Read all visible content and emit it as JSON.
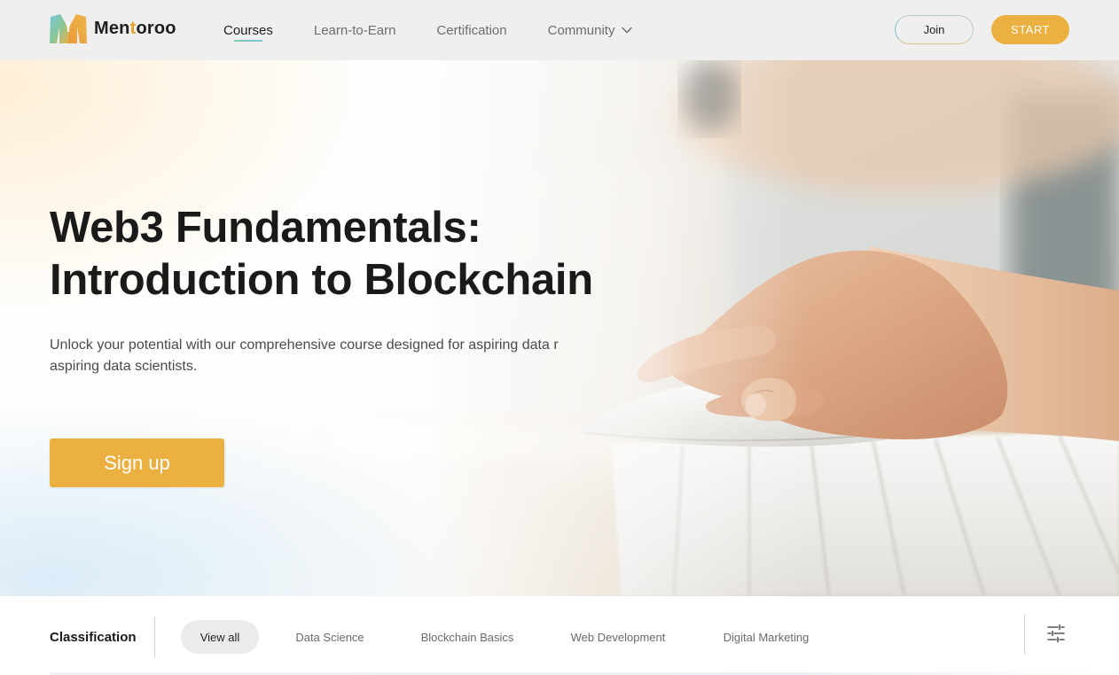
{
  "header": {
    "logo_text_start": "Men",
    "logo_text_accent": "t",
    "logo_text_end": "oroo",
    "nav": [
      {
        "label": "Courses",
        "active": true
      },
      {
        "label": "Learn-to-Earn",
        "active": false
      },
      {
        "label": "Certification",
        "active": false
      },
      {
        "label": "Community",
        "active": false
      }
    ],
    "join_label": "Join",
    "start_label": "START"
  },
  "hero": {
    "title_line1": "Web3 Fundamentals:",
    "title_line2": "Introduction to Blockchain",
    "subtitle_line1": "Unlock your potential with our comprehensive course designed for aspiring data r",
    "subtitle_line2": "aspiring data  scientists.",
    "signup_label": "Sign up"
  },
  "classification": {
    "title": "Classification",
    "chips": [
      {
        "label": "View all",
        "active": true
      },
      {
        "label": "Data Science",
        "active": false
      },
      {
        "label": "Blockchain Basics",
        "active": false
      },
      {
        "label": "Web Development",
        "active": false
      },
      {
        "label": "Digital Marketing",
        "active": false
      }
    ]
  },
  "icons": {
    "logo": "mentoroo-logo-icon",
    "community_dropdown": "chevron-down-icon",
    "filter": "sliders-icon"
  },
  "colors": {
    "accent": "#ECB040",
    "header_bg": "#EFEFEF",
    "text_primary": "#1A1A1A",
    "text_muted": "#6D6D6D",
    "chip_active_bg": "#EBEBEB"
  }
}
